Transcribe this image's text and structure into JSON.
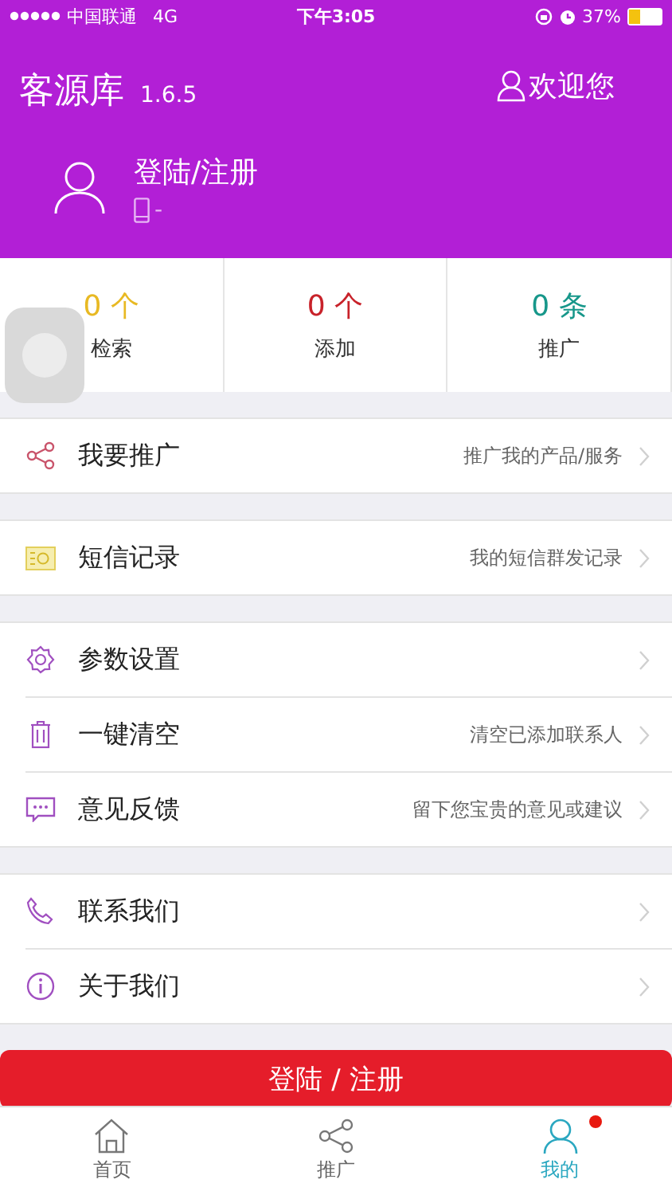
{
  "status_bar": {
    "carrier": "中国联通",
    "network": "4G",
    "time": "下午3:05",
    "battery": "37%"
  },
  "header": {
    "app_name": "客源库",
    "version": "1.6.5",
    "welcome": "欢迎您",
    "login_text": "登陆/注册",
    "phone": "-"
  },
  "stats": [
    {
      "count": "0",
      "unit": "个",
      "label": "检索",
      "color": "#e8b923"
    },
    {
      "count": "0",
      "unit": "个",
      "label": "添加",
      "color": "#c8222a"
    },
    {
      "count": "0",
      "unit": "条",
      "label": "推广",
      "color": "#17978a"
    }
  ],
  "groups": [
    [
      {
        "kind": "share",
        "title": "我要推广",
        "detail": "推广我的产品/服务"
      }
    ],
    [
      {
        "kind": "sms",
        "title": "短信记录",
        "detail": "我的短信群发记录"
      }
    ],
    [
      {
        "kind": "gear",
        "title": "参数设置"
      },
      {
        "kind": "trash",
        "title": "一键清空",
        "detail": "清空已添加联系人"
      },
      {
        "kind": "chat",
        "title": "意见反馈",
        "detail": "留下您宝贵的意见或建议"
      }
    ],
    [
      {
        "kind": "phone",
        "title": "联系我们"
      },
      {
        "kind": "info",
        "title": "关于我们"
      }
    ]
  ],
  "login_button": "登陆 / 注册",
  "tabs": [
    {
      "kind": "home",
      "label": "首页",
      "selected": false,
      "badge": false
    },
    {
      "kind": "share",
      "label": "推广",
      "selected": false,
      "badge": false
    },
    {
      "kind": "person",
      "label": "我的",
      "selected": true,
      "badge": true
    }
  ]
}
